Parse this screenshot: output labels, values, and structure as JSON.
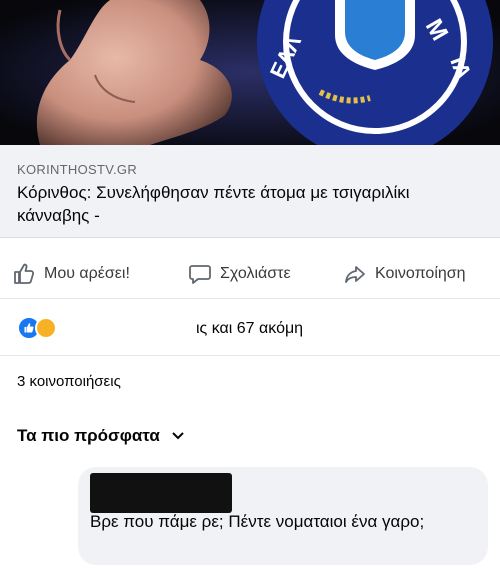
{
  "post": {
    "link": {
      "domain": "KORINTHOSTV.GR",
      "title": "Κόρινθος: Συνελήφθησαν πέντε άτομα με τσιγαριλίκι κάνναβης -"
    },
    "actions": {
      "like_label": "Μου αρέσει!",
      "comment_label": "Σχολιάστε",
      "share_label": "Κοινοποίηση"
    },
    "reactions": {
      "summary_text": "ις και 67 ακόμη"
    },
    "shares_text": "3 κοινοποιήσεις"
  },
  "comments": {
    "sort_label": "Τα πιο πρόσφατα",
    "items": [
      {
        "text": "Βρε που πάμε ρε; Πέντε νοματαιοι ένα γαρο;"
      }
    ]
  },
  "colors": {
    "facebook_blue": "#1877f2",
    "bubble_grey": "#f0f2f5",
    "icon_grey": "#606770"
  },
  "icons": [
    "thumbs-up-icon",
    "comment-icon",
    "share-icon",
    "chevron-down-icon",
    "like-reaction-icon",
    "haha-reaction-icon"
  ]
}
